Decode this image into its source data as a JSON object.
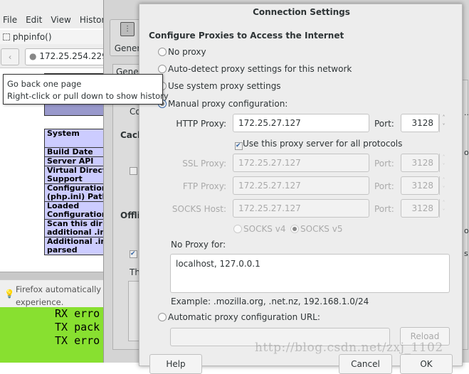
{
  "browser": {
    "menu": [
      "File",
      "Edit",
      "View",
      "History"
    ],
    "tab_title": "phpinfo()",
    "url": "172.25.254.229",
    "tooltip": [
      "Go back one page",
      "Right-click or pull down to show history"
    ],
    "php_rows": [
      "System",
      "Build Date",
      "Server API",
      "Virtual Directory Support",
      "Configuration (php.ini) Path",
      "Loaded Configuration",
      "Scan this dir for additional .ini",
      "Additional .ini parsed"
    ],
    "notification": {
      "line1": "Firefox automatically s",
      "line2": "experience."
    }
  },
  "terminal": {
    "lines": [
      "RX erro",
      "TX pack",
      "TX erro"
    ],
    "bg": "#88e030"
  },
  "prefs": {
    "toolbar_label": "Gener",
    "tab_label": "Gener",
    "co": "Co",
    "cach": "Cach",
    "offli": "Offli",
    "th": "Th",
    "right_frag": [
      "...",
      "ov",
      "ov",
      "s."
    ]
  },
  "dialog": {
    "title": "Connection Settings",
    "heading": "Configure Proxies to Access the Internet",
    "options": [
      "No proxy",
      "Auto-detect proxy settings for this network",
      "Use system proxy settings",
      "Manual proxy configuration:"
    ],
    "selected": "Manual proxy configuration:",
    "http": {
      "label": "HTTP Proxy:",
      "value": "172.25.27.127",
      "port_label": "Port:",
      "port": "3128"
    },
    "use_all": {
      "label": "Use this proxy server for all protocols",
      "checked": true
    },
    "ssl": {
      "label": "SSL Proxy:",
      "value": "172.25.27.127",
      "port_label": "Port:",
      "port": "3128"
    },
    "ftp": {
      "label": "FTP Proxy:",
      "value": "172.25.27.127",
      "port_label": "Port:",
      "port": "3128"
    },
    "socks": {
      "label": "SOCKS Host:",
      "value": "172.25.27.127",
      "port_label": "Port:",
      "port": "3128"
    },
    "socks_v4": "SOCKS v4",
    "socks_v5": "SOCKS v5",
    "socks_selected": "SOCKS v5",
    "no_proxy_label": "No Proxy for:",
    "no_proxy_value": "localhost, 127.0.0.1",
    "example": "Example: .mozilla.org, .net.nz, 192.168.1.0/24",
    "auto_url_label": "Automatic proxy configuration URL:",
    "auto_url_value": "",
    "reload": "Reload",
    "help": "Help",
    "cancel": "Cancel",
    "ok": "OK"
  },
  "watermark": "http://blog.csdn.net/zxj_1102"
}
